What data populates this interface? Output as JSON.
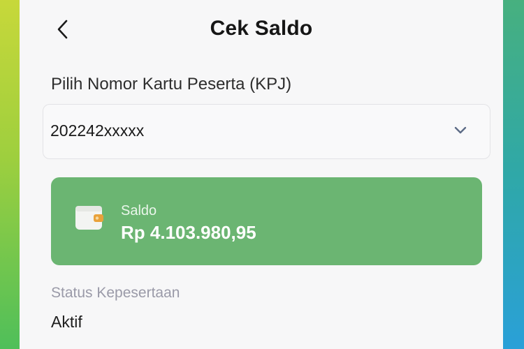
{
  "header": {
    "title": "Cek Saldo",
    "back_icon": "chevron-left-icon"
  },
  "kpj": {
    "label": "Pilih Nomor Kartu Peserta (KPJ)",
    "selected_value": "202242xxxxx",
    "dropdown_icon": "chevron-down-icon"
  },
  "saldo": {
    "label": "Saldo",
    "amount": "Rp 4.103.980,95",
    "icon": "wallet-icon",
    "card_color": "#6bb572"
  },
  "status": {
    "label": "Status Kepesertaan",
    "value": "Aktif"
  }
}
